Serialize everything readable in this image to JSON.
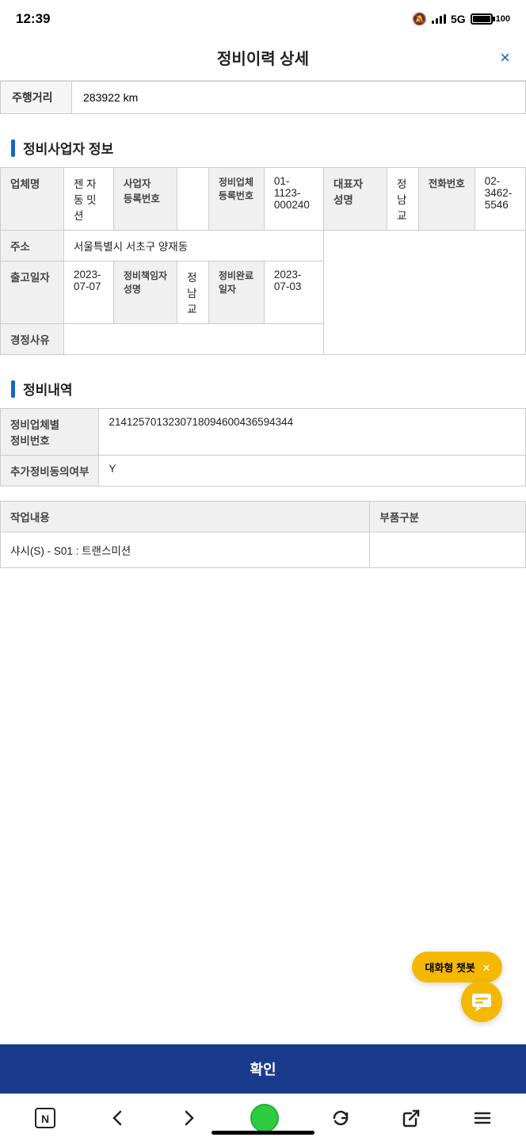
{
  "statusBar": {
    "time": "12:39",
    "network": "5G",
    "battery": "100"
  },
  "header": {
    "title": "정비이력 상세",
    "closeLabel": "×"
  },
  "mileage": {
    "label": "주행거리",
    "value": "283922 km"
  },
  "sections": {
    "businessInfo": {
      "title": "정비사업자 정보",
      "fields": {
        "companyNameLabel": "업체명",
        "companyNameValue": "젠 자동 밋션",
        "bizRegNoLabel": "사업자 등록번호",
        "bizRegNoValue": "",
        "maintenanceBizRegNoLabel": "정비업체 등록번호",
        "maintenanceBizRegNoValue": "01-1123-000240",
        "repNameLabel": "대표자 성명",
        "repNameValue": "정남교",
        "phoneLabel": "전화번호",
        "phoneValue": "02-3462-5546",
        "addressLabel": "주소",
        "addressValue": "서울특별시 서초구 양재동",
        "checkoutDateLabel": "출고일자",
        "checkoutDateValue": "2023-07-07",
        "maintenancePersonLabel": "정비책임자 성명",
        "maintenancePersonValue": "정남교",
        "completeDateLabel": "정비완료 일자",
        "completeDateValue": "2023-07-03",
        "correctionReasonLabel": "경정사유",
        "correctionReasonValue": ""
      }
    },
    "maintenanceDetail": {
      "title": "정비내역",
      "fields": {
        "maintenanceNoLabel": "정비업체별 정비번호",
        "maintenanceNoValue": "2141257013230718094600436594344",
        "additionalConsentLabel": "추가정비동의여부",
        "additionalConsentValue": "Y"
      },
      "workTable": {
        "columns": [
          "작업내용",
          "부품구분"
        ],
        "rows": [
          {
            "work": "샤시(S) - S01 : 트랜스미션",
            "parts": ""
          }
        ]
      }
    }
  },
  "chatBubble": {
    "label": "대화형 챗봇",
    "closeLabel": "×"
  },
  "confirmButton": {
    "label": "확인"
  },
  "bottomNav": {
    "items": [
      "N",
      "←",
      "→",
      "●",
      "↺",
      "↗",
      "≡"
    ]
  }
}
